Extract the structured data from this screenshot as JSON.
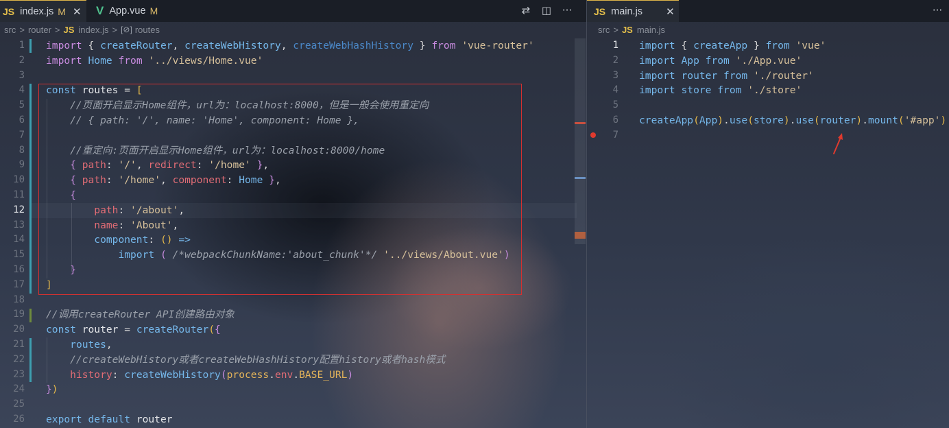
{
  "left_editor": {
    "tabs": [
      {
        "lang": "JS",
        "name": "index.js",
        "status": "M",
        "close": "✕"
      },
      {
        "lang": "V",
        "name": "App.vue",
        "status": "M"
      }
    ],
    "actions": {
      "compare": "⇄",
      "split": "◫",
      "more": "···"
    },
    "breadcrumb": {
      "folder1": "src",
      "folder2": "router",
      "js": "JS",
      "file": "index.js",
      "symbol_icon": "[⊘]",
      "symbol": "routes",
      "sep": ">"
    },
    "line_numbers": [
      "1",
      "2",
      "3",
      "4",
      "5",
      "6",
      "7",
      "8",
      "9",
      "10",
      "11",
      "12",
      "13",
      "14",
      "15",
      "16",
      "17",
      "18",
      "19",
      "20",
      "21",
      "22",
      "23",
      "24",
      "25",
      "26"
    ],
    "lines": [
      [
        [
          "import",
          "#c98ce0"
        ],
        [
          " { ",
          "#d8d8d8"
        ],
        [
          "createRouter",
          "#75b7ea"
        ],
        [
          ", ",
          "#d8d8d8"
        ],
        [
          "createWebHistory",
          "#75b7ea"
        ],
        [
          ", ",
          "#d8d8d8"
        ],
        [
          "createWebHashHistory",
          "#4b88c8"
        ],
        [
          " } ",
          "#d8d8d8"
        ],
        [
          "from",
          "#c98ce0"
        ],
        [
          " ",
          "#d8d8d8"
        ],
        [
          "'vue-router'",
          "#d6c09a"
        ]
      ],
      [
        [
          "import",
          "#c98ce0"
        ],
        [
          " ",
          "#d8d8d8"
        ],
        [
          "Home",
          "#75b7ea"
        ],
        [
          " ",
          "#d8d8d8"
        ],
        [
          "from",
          "#c98ce0"
        ],
        [
          " ",
          "#d8d8d8"
        ],
        [
          "'../views/Home.vue'",
          "#d6c09a"
        ]
      ],
      [],
      [
        [
          "const",
          "#75b7ea"
        ],
        [
          " ",
          "#d8d8d8"
        ],
        [
          "routes",
          "#e3e5e8"
        ],
        [
          " = ",
          "#d8d8d8"
        ],
        [
          "[",
          "#e6b94a"
        ]
      ],
      [
        [
          "    //页面开启显示Home组件，url为：localhost:8000，但是一般会使用重定向",
          "#9aa0aa",
          "it"
        ]
      ],
      [
        [
          "    // { path: '/', name: 'Home', component: Home },",
          "#9aa0aa",
          "it"
        ]
      ],
      [],
      [
        [
          "    //重定向:页面开启显示Home组件，url为：localhost:8000/home",
          "#9aa0aa",
          "it"
        ]
      ],
      [
        [
          "    ",
          "#d8d8d8"
        ],
        [
          "{",
          "#c98ce0"
        ],
        [
          " ",
          "#d8d8d8"
        ],
        [
          "path",
          "#e06c75"
        ],
        [
          ": ",
          "#d8d8d8"
        ],
        [
          "'/'",
          "#d6c09a"
        ],
        [
          ", ",
          "#d8d8d8"
        ],
        [
          "redirect",
          "#e06c75"
        ],
        [
          ": ",
          "#d8d8d8"
        ],
        [
          "'/home'",
          "#d6c09a"
        ],
        [
          " ",
          "#d8d8d8"
        ],
        [
          "}",
          "#c98ce0"
        ],
        [
          ",",
          "#d8d8d8"
        ]
      ],
      [
        [
          "    ",
          "#d8d8d8"
        ],
        [
          "{",
          "#c98ce0"
        ],
        [
          " ",
          "#d8d8d8"
        ],
        [
          "path",
          "#e06c75"
        ],
        [
          ": ",
          "#d8d8d8"
        ],
        [
          "'/home'",
          "#d6c09a"
        ],
        [
          ", ",
          "#d8d8d8"
        ],
        [
          "component",
          "#e06c75"
        ],
        [
          ": ",
          "#d8d8d8"
        ],
        [
          "Home",
          "#75b7ea"
        ],
        [
          " ",
          "#d8d8d8"
        ],
        [
          "}",
          "#c98ce0"
        ],
        [
          ",",
          "#d8d8d8"
        ]
      ],
      [
        [
          "    ",
          "#d8d8d8"
        ],
        [
          "{",
          "#c98ce0"
        ]
      ],
      [
        [
          "        ",
          "#d8d8d8"
        ],
        [
          "path",
          "#e06c75"
        ],
        [
          ": ",
          "#d8d8d8"
        ],
        [
          "'/about'",
          "#d6c09a"
        ],
        [
          ",",
          "#d8d8d8"
        ]
      ],
      [
        [
          "        ",
          "#d8d8d8"
        ],
        [
          "name",
          "#e06c75"
        ],
        [
          ": ",
          "#d8d8d8"
        ],
        [
          "'About'",
          "#d6c09a"
        ],
        [
          ",",
          "#d8d8d8"
        ]
      ],
      [
        [
          "        ",
          "#d8d8d8"
        ],
        [
          "component",
          "#75b7ea"
        ],
        [
          ": ",
          "#d8d8d8"
        ],
        [
          "()",
          "#e6b94a"
        ],
        [
          " ",
          "#d8d8d8"
        ],
        [
          "=>",
          "#75b7ea"
        ]
      ],
      [
        [
          "            ",
          "#d8d8d8"
        ],
        [
          "import",
          "#75b7ea"
        ],
        [
          " ",
          "#d8d8d8"
        ],
        [
          "(",
          "#c98ce0"
        ],
        [
          " ",
          "#d8d8d8"
        ],
        [
          "/*webpackChunkName:'about_chunk'*/",
          "#9aa0aa",
          "it"
        ],
        [
          " ",
          "#d8d8d8"
        ],
        [
          "'../views/About.vue'",
          "#d6c09a"
        ],
        [
          ")",
          "#c98ce0"
        ]
      ],
      [
        [
          "    ",
          "#d8d8d8"
        ],
        [
          "}",
          "#c98ce0"
        ]
      ],
      [
        [
          "]",
          "#e6b94a"
        ]
      ],
      [],
      [
        [
          "//调用createRouter API创建路由对象",
          "#9aa0aa",
          "it"
        ]
      ],
      [
        [
          "const",
          "#75b7ea"
        ],
        [
          " ",
          "#d8d8d8"
        ],
        [
          "router",
          "#e3e5e8"
        ],
        [
          " = ",
          "#d8d8d8"
        ],
        [
          "createRouter",
          "#75b7ea"
        ],
        [
          "(",
          "#e6b94a"
        ],
        [
          "{",
          "#c98ce0"
        ]
      ],
      [
        [
          "    ",
          "#d8d8d8"
        ],
        [
          "routes",
          "#75b7ea"
        ],
        [
          ",",
          "#d8d8d8"
        ]
      ],
      [
        [
          "    //createWebHistory或者createWebHashHistory配置history或者hash模式",
          "#9aa0aa",
          "it"
        ]
      ],
      [
        [
          "    ",
          "#d8d8d8"
        ],
        [
          "history",
          "#e06c75"
        ],
        [
          ": ",
          "#d8d8d8"
        ],
        [
          "createWebHistory",
          "#75b7ea"
        ],
        [
          "(",
          "#c98ce0"
        ],
        [
          "process",
          "#e3b35a"
        ],
        [
          ".",
          "#d8d8d8"
        ],
        [
          "env",
          "#e06c75"
        ],
        [
          ".",
          "#d8d8d8"
        ],
        [
          "BASE_URL",
          "#e3b35a"
        ],
        [
          ")",
          "#c98ce0"
        ]
      ],
      [
        [
          "}",
          "#c98ce0"
        ],
        [
          ")",
          "#e6b94a"
        ]
      ],
      [],
      [
        [
          "export",
          "#75b7ea"
        ],
        [
          " ",
          "#d8d8d8"
        ],
        [
          "default",
          "#75b7ea"
        ],
        [
          " ",
          "#d8d8d8"
        ],
        [
          "router",
          "#e3e5e8"
        ]
      ]
    ]
  },
  "right_editor": {
    "tabs": [
      {
        "lang": "JS",
        "name": "main.js",
        "close": "✕"
      }
    ],
    "actions": {
      "more": "···"
    },
    "breadcrumb": {
      "folder1": "src",
      "js": "JS",
      "file": "main.js",
      "sep": ">"
    },
    "line_numbers": [
      "1",
      "2",
      "3",
      "4",
      "5",
      "6",
      "7"
    ],
    "lines": [
      [
        [
          "import",
          "#75b7ea"
        ],
        [
          " { ",
          "#d8d8d8"
        ],
        [
          "createApp",
          "#75b7ea"
        ],
        [
          " } ",
          "#d8d8d8"
        ],
        [
          "from",
          "#75b7ea"
        ],
        [
          " ",
          "#d8d8d8"
        ],
        [
          "'vue'",
          "#d6c09a"
        ]
      ],
      [
        [
          "import",
          "#75b7ea"
        ],
        [
          " ",
          "#d8d8d8"
        ],
        [
          "App",
          "#75b7ea"
        ],
        [
          " ",
          "#d8d8d8"
        ],
        [
          "from",
          "#75b7ea"
        ],
        [
          " ",
          "#d8d8d8"
        ],
        [
          "'./App.vue'",
          "#d6c09a"
        ]
      ],
      [
        [
          "import",
          "#75b7ea"
        ],
        [
          " ",
          "#d8d8d8"
        ],
        [
          "router",
          "#75b7ea"
        ],
        [
          " ",
          "#d8d8d8"
        ],
        [
          "from",
          "#75b7ea"
        ],
        [
          " ",
          "#d8d8d8"
        ],
        [
          "'./router'",
          "#d6c09a"
        ]
      ],
      [
        [
          "import",
          "#75b7ea"
        ],
        [
          " ",
          "#d8d8d8"
        ],
        [
          "store",
          "#75b7ea"
        ],
        [
          " ",
          "#d8d8d8"
        ],
        [
          "from",
          "#75b7ea"
        ],
        [
          " ",
          "#d8d8d8"
        ],
        [
          "'./store'",
          "#d6c09a"
        ]
      ],
      [],
      [
        [
          "createApp",
          "#75b7ea"
        ],
        [
          "(",
          "#e6b94a"
        ],
        [
          "App",
          "#75b7ea"
        ],
        [
          ")",
          "#e6b94a"
        ],
        [
          ".",
          "#d8d8d8"
        ],
        [
          "use",
          "#75b7ea"
        ],
        [
          "(",
          "#e6b94a"
        ],
        [
          "store",
          "#75b7ea"
        ],
        [
          ")",
          "#e6b94a"
        ],
        [
          ".",
          "#d8d8d8"
        ],
        [
          "use",
          "#75b7ea"
        ],
        [
          "(",
          "#e6b94a"
        ],
        [
          "router",
          "#75b7ea"
        ],
        [
          ")",
          "#e6b94a"
        ],
        [
          ".",
          "#d8d8d8"
        ],
        [
          "mount",
          "#75b7ea"
        ],
        [
          "(",
          "#e6b94a"
        ],
        [
          "'#app'",
          "#d6c09a"
        ],
        [
          ")",
          "#e6b94a"
        ]
      ],
      []
    ]
  },
  "colors": {
    "highlight_box": "#d53030",
    "annotation_arrow": "#e03a2e",
    "breakpoint": "#e03a2e",
    "tab_border": "#e0b64a"
  }
}
